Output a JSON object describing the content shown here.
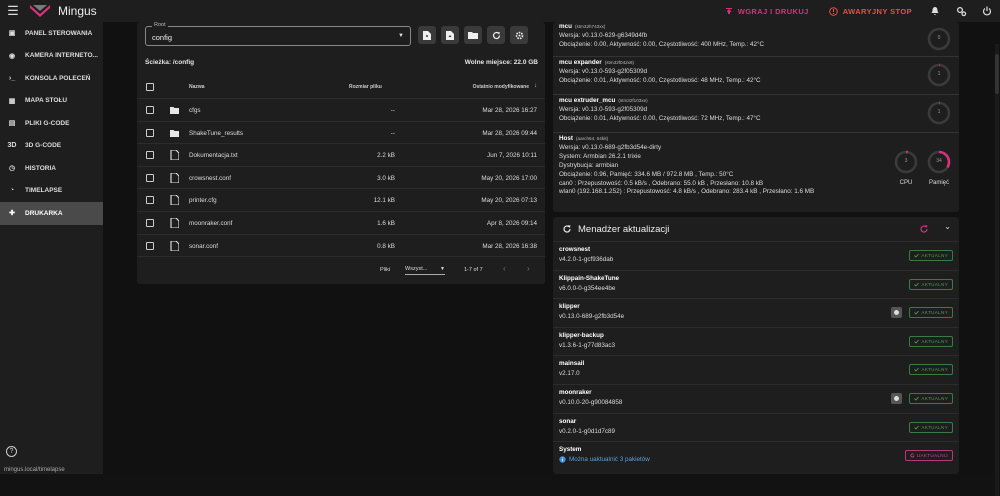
{
  "app": {
    "title": "Mingus"
  },
  "topbar": {
    "print_label": "WGRAJ I DRUKUJ",
    "estop_label": "AWARYJNY STOP"
  },
  "sidebar": {
    "items": [
      {
        "label": "PANEL STEROWANIA",
        "icon": "dashboard-icon"
      },
      {
        "label": "KAMERA INTERNETO...",
        "icon": "webcam-icon"
      },
      {
        "label": "KONSOLA POLECEŃ",
        "icon": "console-icon"
      },
      {
        "label": "MAPA STOŁU",
        "icon": "grid-icon"
      },
      {
        "label": "PLIKI G-CODE",
        "icon": "file-icon"
      },
      {
        "label": "3D G-CODE",
        "icon": "3d-icon",
        "icon_text": "3D"
      },
      {
        "label": "HISTORIA",
        "icon": "history-icon"
      },
      {
        "label": "TIMELAPSE",
        "icon": "timelapse-icon"
      },
      {
        "label": "DRUKARKA",
        "icon": "wrench-icon"
      }
    ],
    "active_index": 8,
    "help_glyph": "?",
    "footer_url": "mingus.local/timelapse"
  },
  "filebrowser": {
    "root_label": "Root",
    "root_value": "config",
    "path": "Ścieżka: /config",
    "free_space": "Wolne miejsce: 22.0 GB",
    "columns": {
      "name": "Nazwa",
      "size": "Rozmiar pliku",
      "modified": "Ostatnio modyfikowane"
    },
    "rows": [
      {
        "name": "cfgs",
        "size": "--",
        "date": "Mar 28, 2026 16:27",
        "type": "folder"
      },
      {
        "name": "ShakeTune_results",
        "size": "--",
        "date": "Mar 28, 2026 09:44",
        "type": "folder"
      },
      {
        "name": "Dokumentacja.txt",
        "size": "2.2 kB",
        "date": "Jun 7, 2026 10:11",
        "type": "file"
      },
      {
        "name": "crowsnest.conf",
        "size": "3.0 kB",
        "date": "May 20, 2026 17:00",
        "type": "file"
      },
      {
        "name": "printer.cfg",
        "size": "12.1 kB",
        "date": "May 20, 2026 07:13",
        "type": "file"
      },
      {
        "name": "moonraker.conf",
        "size": "1.6 kB",
        "date": "Apr 8, 2026 09:14",
        "type": "file"
      },
      {
        "name": "sonar.conf",
        "size": "0.8 kB",
        "date": "Mar 28, 2026 16:38",
        "type": "file"
      }
    ],
    "pagination": {
      "per_page_label": "Pliki",
      "per_page_value": "Wszyst...",
      "range": "1-7 of 7"
    }
  },
  "mcu": {
    "blocks": [
      {
        "name": "mcu",
        "chip": "(stm32h743xx)",
        "lines": [
          "Wersja: v0.13.0-629-g6349d4fb",
          "Obciążenie: 0.00, Aktywność: 0.00, Częstotliwość: 400 MHz, Temp.: 42°C"
        ],
        "gauge": "0",
        "gauge_fraction": 0
      },
      {
        "name": "mcu expander",
        "chip": "(stm32f042x6)",
        "lines": [
          "Wersja: v0.13.0-593-g2f05309d",
          "Obciążenie: 0.01, Aktywność: 0.00, Częstotliwość: 48 MHz, Temp.: 42°C"
        ],
        "gauge": "1",
        "gauge_fraction": 0.01
      },
      {
        "name": "mcu extruder_mcu",
        "chip": "(stm32f103xe)",
        "lines": [
          "Wersja: v0.13.0-593-g2f05309d",
          "Obciążenie: 0.01, Aktywność: 0.00, Częstotliwość: 72 MHz, Temp.: 47°C"
        ],
        "gauge": "1",
        "gauge_fraction": 0.01
      }
    ],
    "host": {
      "name": "Host",
      "chip": "(aarch64, 64bit)",
      "lines": [
        "Wersja: v0.13.0-689-g2fb3d54e-dirty",
        "System: Armbian 26.2.1 trixie",
        "Dystrybucja: armbian",
        "Obciążenie: 0.96, Pamięć: 334.6 MB / 972.8 MB , Temp.: 50°C",
        "can0 : Przepustowość: 0.5 kB/s , Odebrano: 55.0 kB , Przesłano: 10.8 kB",
        "wlan0 (192.168.1.252) : Przepustowość: 4.8 kB/s , Odebrano: 283.4 kB , Przesłano: 1.6 MB"
      ],
      "cpu_value": "3",
      "cpu_fraction": 0.03,
      "cpu_label": "CPU",
      "mem_value": "34",
      "mem_fraction": 0.34,
      "mem_label": "Pamięć"
    }
  },
  "updates": {
    "title": "Menadżer aktualizacji",
    "rows": [
      {
        "name": "crowsnest",
        "version": "v4.2.0-1-gcf936dab",
        "status": "AKTUALNY",
        "info": false
      },
      {
        "name": "Klippain-ShakeTune",
        "version": "v6.0.0-0-g354ee4be",
        "status": "AKTUALNY",
        "info": false
      },
      {
        "name": "klipper",
        "version": "v0.13.0-689-g2fb3d54e",
        "status": "AKTUALNY",
        "info": true
      },
      {
        "name": "klipper-backup",
        "version": "v1.3.6-1-g77d83ac3",
        "status": "AKTUALNY",
        "info": false
      },
      {
        "name": "mainsail",
        "version": "v2.17.0",
        "status": "AKTUALNY",
        "info": false
      },
      {
        "name": "moonraker",
        "version": "v0.10.0-20-g90084858",
        "status": "AKTUALNY",
        "info": true
      },
      {
        "name": "sonar",
        "version": "v0.2.0-1-g0d1d7c89",
        "status": "AKTUALNY",
        "info": false
      }
    ],
    "system": {
      "name": "System",
      "message": "Można uaktualnić 3 pakietów",
      "button": "UAKTUALNIJ"
    }
  },
  "colors": {
    "accent": "#d8307f",
    "estop": "#e8504b",
    "ok_green": "#4b9b57"
  }
}
